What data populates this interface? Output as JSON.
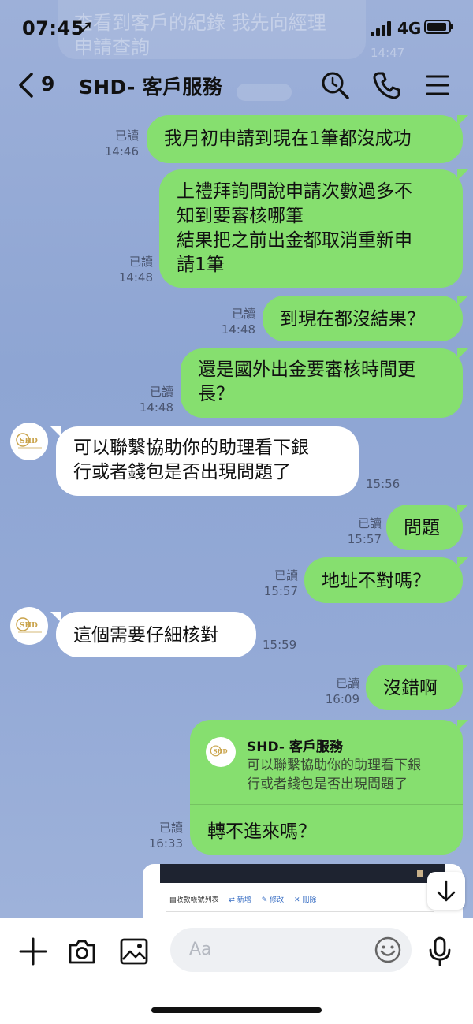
{
  "status": {
    "time": "07:45",
    "location_glyph": "➚",
    "network": "4G"
  },
  "ghost": {
    "text_line1": "查看到客戶的紀錄 我先向經理",
    "text_line2": "申請查詢",
    "time": "14:47"
  },
  "header": {
    "back_count": "9",
    "title": "SHD- 客戶服務"
  },
  "messages": [
    {
      "side": "me",
      "lines": [
        "我月初申請到現在1筆都沒成功"
      ],
      "read": "已讀",
      "time": "14:46"
    },
    {
      "side": "me",
      "lines": [
        "上禮拜詢問說申請次數過多不",
        "知到要審核哪筆",
        "結果把之前出金都取消重新申",
        "請1筆"
      ],
      "read": "已讀",
      "time": "14:48"
    },
    {
      "side": "me",
      "lines": [
        "到現在都沒結果？"
      ],
      "read": "已讀",
      "time": "14:48"
    },
    {
      "side": "me",
      "lines": [
        "還是國外出金要審核時間更",
        "長？"
      ],
      "read": "已讀",
      "time": "14:48"
    },
    {
      "side": "them",
      "lines": [
        "可以聯繫協助你的助理看下銀",
        "行或者錢包是否出現問題了"
      ],
      "time": "15:56"
    },
    {
      "side": "me",
      "lines": [
        "問題"
      ],
      "read": "已讀",
      "time": "15:57"
    },
    {
      "side": "me",
      "lines": [
        "地址不對嗎？"
      ],
      "read": "已讀",
      "time": "15:57"
    },
    {
      "side": "them",
      "lines": [
        "這個需要仔細核對"
      ],
      "time": "15:59"
    },
    {
      "side": "me",
      "lines": [
        "沒錯啊"
      ],
      "read": "已讀",
      "time": "16:09"
    }
  ],
  "reply": {
    "quoted_name": "SHD- 客戶服務",
    "quoted_line1": "可以聯繫協助你的助理看下銀",
    "quoted_line2": "行或者錢包是否出現問題了",
    "text": "轉不進來嗎？",
    "read": "已讀",
    "time": "16:33"
  },
  "image_preview": {
    "toolbar_title": "收款帳號列表",
    "action_add": "新增",
    "action_edit": "修改",
    "action_delete": "刪除"
  },
  "input": {
    "placeholder": "Aa"
  },
  "colors": {
    "my_bubble": "#86df6f",
    "their_bubble": "#ffffff",
    "chat_bg": "#8fa7d4"
  }
}
